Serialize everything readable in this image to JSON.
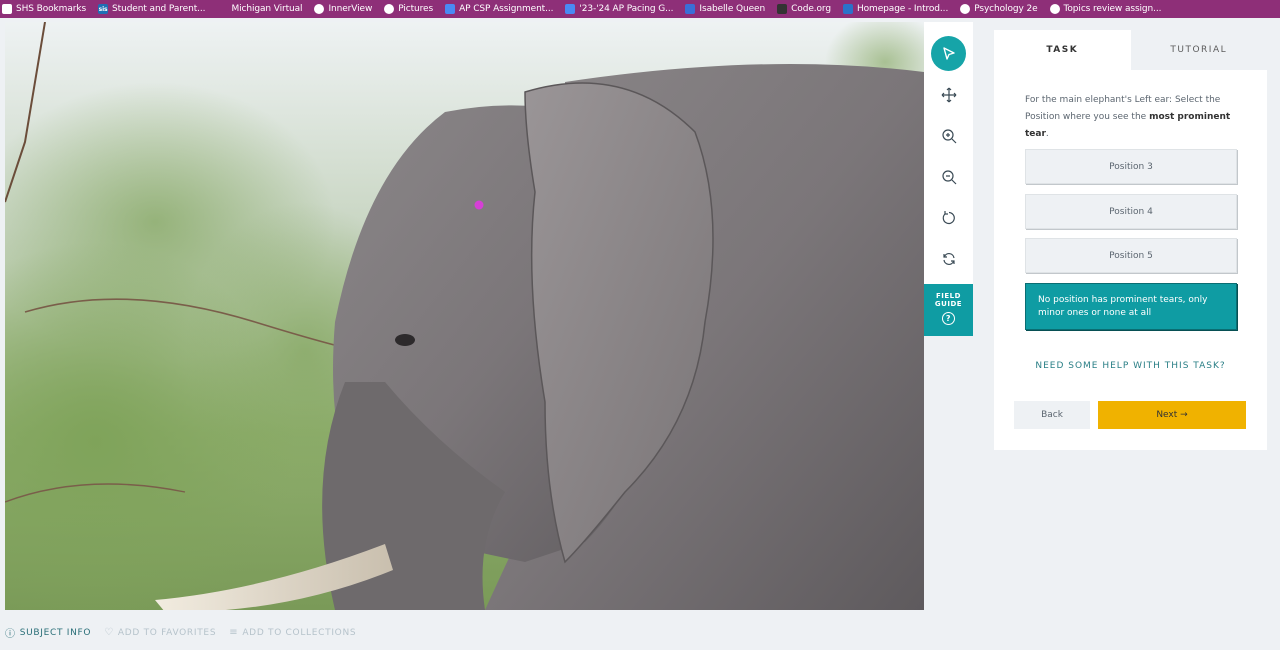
{
  "bookmarks": [
    {
      "label": "SHS Bookmarks",
      "icon": "folder-icon",
      "color": "#ffffff"
    },
    {
      "label": "Student and Parent...",
      "icon": "sis-icon",
      "color": "#1f6fb5"
    },
    {
      "label": "Michigan Virtual",
      "icon": "mv-icon",
      "color": "#8e2f78"
    },
    {
      "label": "InnerView",
      "icon": "innerview-icon",
      "color": "#ffffff"
    },
    {
      "label": "Pictures",
      "icon": "pictures-icon",
      "color": "#ffffff"
    },
    {
      "label": "AP CSP Assignment...",
      "icon": "docs-icon",
      "color": "#4a8af4"
    },
    {
      "label": "'23-'24 AP Pacing G...",
      "icon": "docs-icon",
      "color": "#4a8af4"
    },
    {
      "label": "Isabelle Queen",
      "icon": "classroom-icon",
      "color": "#3a6fd8"
    },
    {
      "label": "Code.org",
      "icon": "codeorg-icon",
      "color": "#333333"
    },
    {
      "label": "Homepage - Introd...",
      "icon": "homepage-icon",
      "color": "#2b72c9"
    },
    {
      "label": "Psychology 2e",
      "icon": "globe-icon",
      "color": "#ffffff"
    },
    {
      "label": "Topics review assign...",
      "icon": "globe-icon",
      "color": "#ffffff"
    }
  ],
  "toolbar": {
    "tools": [
      "pointer-icon",
      "move-icon",
      "zoom-in-icon",
      "zoom-out-icon",
      "rotate-icon",
      "reset-icon"
    ],
    "field_guide_line1": "FIELD",
    "field_guide_line2": "GUIDE",
    "field_guide_q": "?"
  },
  "panel": {
    "tab_task": "TASK",
    "tab_tutorial": "TUTORIAL",
    "instruction_pre": "For the main elephant's Left ear: Select the Position where you see the ",
    "instruction_bold": "most prominent tear",
    "instruction_post": ".",
    "answers": [
      {
        "label": "Position 3",
        "selected": false
      },
      {
        "label": "Position 4",
        "selected": false
      },
      {
        "label": "Position 5",
        "selected": false
      },
      {
        "label": "No position has prominent tears, only minor ones or none at all",
        "selected": true
      }
    ],
    "help": "NEED SOME HELP WITH THIS TASK?",
    "back": "Back",
    "next": "Next →"
  },
  "meta": {
    "subject_info": "SUBJECT INFO",
    "favorites": "ADD TO FAVORITES",
    "collections": "ADD TO COLLECTIONS"
  },
  "colors": {
    "bookmark_bar": "#8e2f78",
    "teal": "#0f9ca3",
    "next": "#f0b200",
    "marker": "#d63fd6"
  }
}
